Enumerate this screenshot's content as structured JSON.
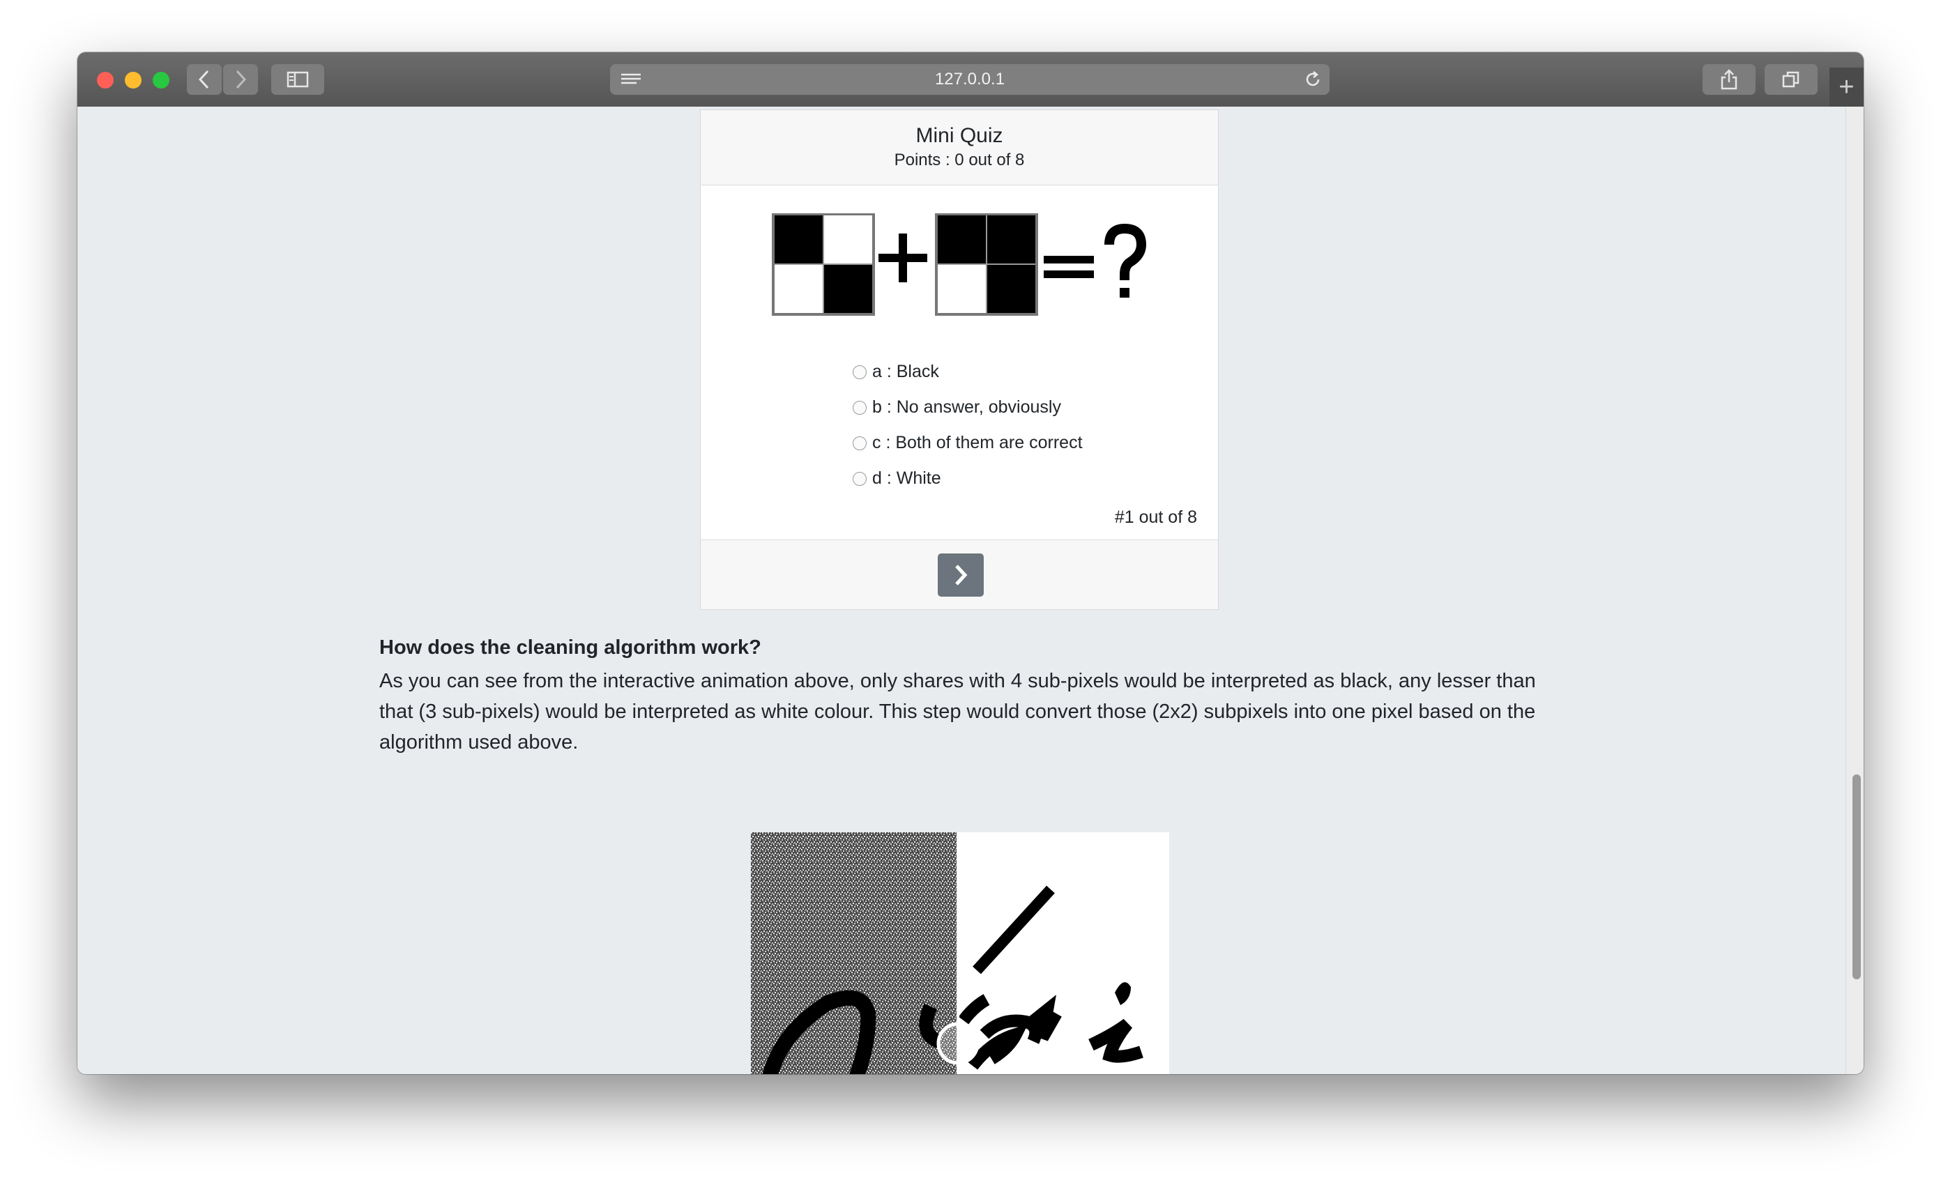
{
  "browser": {
    "url": "127.0.0.1",
    "colors": {
      "close": "#fe5f57",
      "minimize": "#febc2e",
      "maximize": "#28c840"
    },
    "icons": [
      "back-icon",
      "forward-icon",
      "sidebar-icon",
      "reader-icon",
      "reload-icon",
      "share-icon",
      "tabs-icon",
      "plus-icon"
    ]
  },
  "quiz": {
    "title": "Mini Quiz",
    "points": "Points : 0 out of 8",
    "options": [
      {
        "label": "a : Black"
      },
      {
        "label": "b : No answer, obviously"
      },
      {
        "label": "c : Both of them are correct"
      },
      {
        "label": "d : White"
      }
    ],
    "question_count": "#1 out of 8"
  },
  "article": {
    "heading": "How does the cleaning algorithm work?",
    "paragraph": "As you can see from the interactive animation above, only shares with 4 sub-pixels would be interpreted as black, any lesser than that (3 sub-pixels) would be interpreted as white colour. This step would convert those (2x2) subpixels into one pixel based on the algorithm used above."
  }
}
